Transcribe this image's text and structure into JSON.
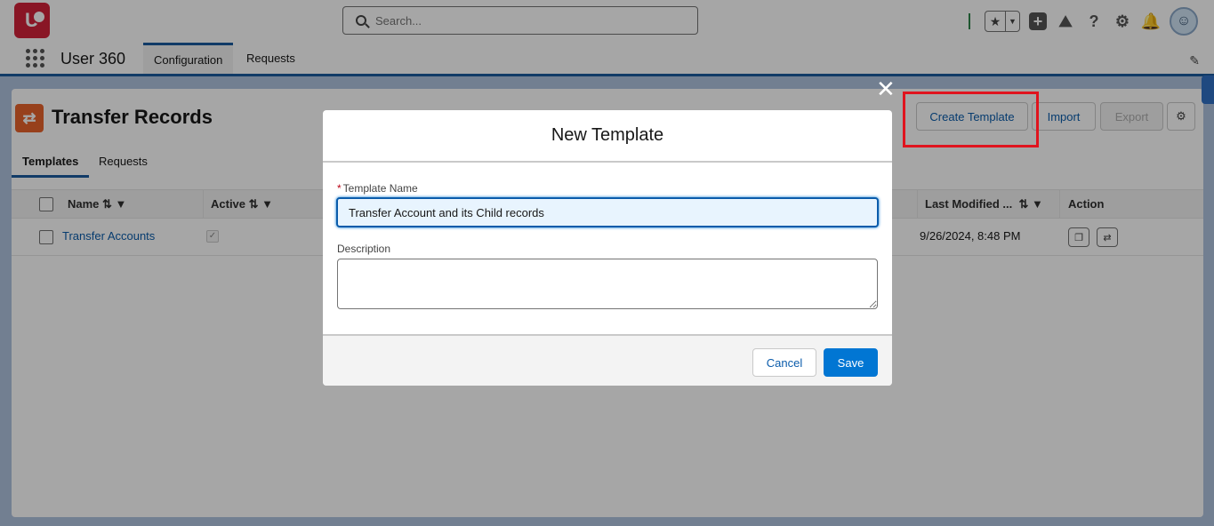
{
  "header": {
    "logo_text": "U",
    "search_placeholder": "Search..."
  },
  "app_nav": {
    "app_name": "User 360",
    "tabs": [
      {
        "label": "Configuration",
        "active": true
      },
      {
        "label": "Requests",
        "active": false
      }
    ]
  },
  "page": {
    "title": "Transfer Records",
    "tabs": [
      {
        "label": "Templates",
        "active": true
      },
      {
        "label": "Requests",
        "active": false
      }
    ],
    "buttons": {
      "create_template": "Create Template",
      "import": "Import",
      "export": "Export"
    },
    "table": {
      "columns": [
        "Name",
        "Active",
        "Last Modified ...",
        "Action"
      ],
      "rows": [
        {
          "name": "Transfer Accounts",
          "active": true,
          "last_modified": "9/26/2024, 8:48 PM"
        }
      ]
    }
  },
  "modal": {
    "title": "New Template",
    "template_name_label": "Template Name",
    "template_name_value": "Transfer Account and its Child records",
    "description_label": "Description",
    "description_value": "",
    "cancel_label": "Cancel",
    "save_label": "Save"
  },
  "colors": {
    "brand_blue": "#0176d3",
    "link_blue": "#0b5cab",
    "logo_red": "#d3223a",
    "page_icon_orange": "#e8632c",
    "highlight_red": "#e0141e"
  }
}
